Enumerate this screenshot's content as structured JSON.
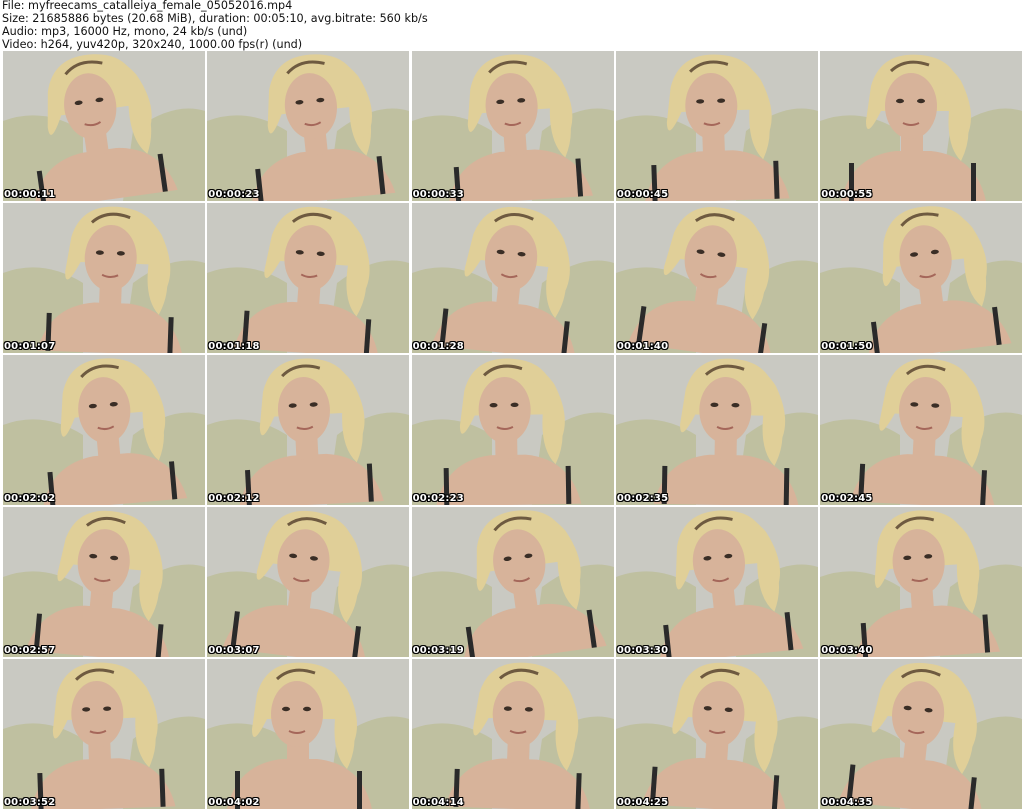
{
  "header": {
    "file_line": "File: myfreecams_catalleiya_female_05052016.mp4",
    "size_line": "Size: 21685886 bytes (20.68 MiB), duration: 00:05:10, avg.bitrate: 560 kb/s",
    "audio_line": "Audio: mp3, 16000 Hz, mono, 24 kb/s (und)",
    "video_line": "Video: h264, yuv420p, 320x240, 1000.00 fps(r) (und)"
  },
  "thumbnails": [
    {
      "timestamp": "00:00:11"
    },
    {
      "timestamp": "00:00:23"
    },
    {
      "timestamp": "00:00:33"
    },
    {
      "timestamp": "00:00:45"
    },
    {
      "timestamp": "00:00:55"
    },
    {
      "timestamp": "00:01:07"
    },
    {
      "timestamp": "00:01:18"
    },
    {
      "timestamp": "00:01:28"
    },
    {
      "timestamp": "00:01:40"
    },
    {
      "timestamp": "00:01:50"
    },
    {
      "timestamp": "00:02:02"
    },
    {
      "timestamp": "00:02:12"
    },
    {
      "timestamp": "00:02:23"
    },
    {
      "timestamp": "00:02:35"
    },
    {
      "timestamp": "00:02:45"
    },
    {
      "timestamp": "00:02:57"
    },
    {
      "timestamp": "00:03:07"
    },
    {
      "timestamp": "00:03:19"
    },
    {
      "timestamp": "00:03:30"
    },
    {
      "timestamp": "00:03:40"
    },
    {
      "timestamp": "00:03:52"
    },
    {
      "timestamp": "00:04:02"
    },
    {
      "timestamp": "00:04:14"
    },
    {
      "timestamp": "00:04:25"
    },
    {
      "timestamp": "00:04:35"
    }
  ],
  "colors": {
    "wall": "#c9c9c2",
    "sofa": "#bfc0a0",
    "skin": "#d7b39a",
    "hair": "#e0cf98",
    "hair_dark": "#6e5a40",
    "strap": "#2a2a2a"
  }
}
